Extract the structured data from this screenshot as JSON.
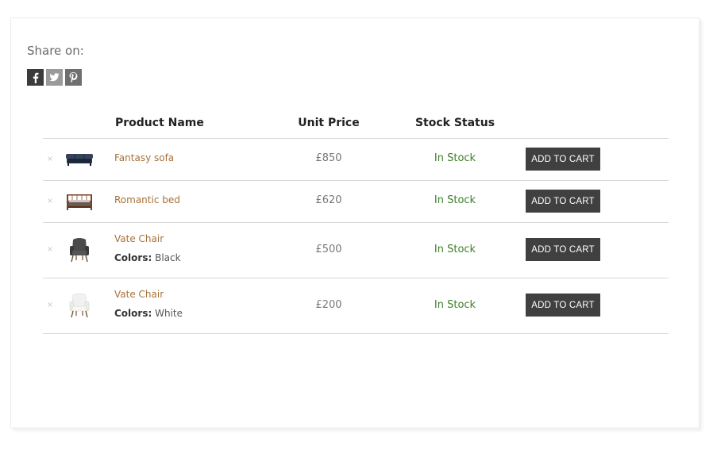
{
  "share": {
    "label": "Share on:",
    "icons": [
      {
        "name": "facebook-icon",
        "glyph": "f",
        "color": "#3b3b3b"
      },
      {
        "name": "twitter-icon",
        "color": "#9a9a9a"
      },
      {
        "name": "pinterest-icon",
        "color": "#6f6f6f"
      }
    ]
  },
  "table": {
    "headers": {
      "name": "Product Name",
      "price": "Unit Price",
      "stock": "Stock Status"
    },
    "rows": [
      {
        "remove": "×",
        "name": "Fantasy sofa",
        "thumbnail": "sofa-thumbnail",
        "variation_label": "",
        "variation_value": "",
        "price": "£850",
        "stock": "In Stock",
        "cart": "ADD TO CART"
      },
      {
        "remove": "×",
        "name": "Romantic bed",
        "thumbnail": "bed-thumbnail",
        "variation_label": "",
        "variation_value": "",
        "price": "£620",
        "stock": "In Stock",
        "cart": "ADD TO CART"
      },
      {
        "remove": "×",
        "name": "Vate Chair",
        "thumbnail": "dark-chair-thumbnail",
        "variation_label": "Colors:",
        "variation_value": " Black",
        "price": "£500",
        "stock": "In Stock",
        "cart": "ADD TO CART"
      },
      {
        "remove": "×",
        "name": "Vate Chair",
        "thumbnail": "white-chair-thumbnail",
        "variation_label": "Colors:",
        "variation_value": " White",
        "price": "£200",
        "stock": "In Stock",
        "cart": "ADD TO CART"
      }
    ]
  },
  "colors": {
    "product_link": "#a8713b",
    "in_stock": "#3f7f2a",
    "button_bg": "#404040"
  }
}
